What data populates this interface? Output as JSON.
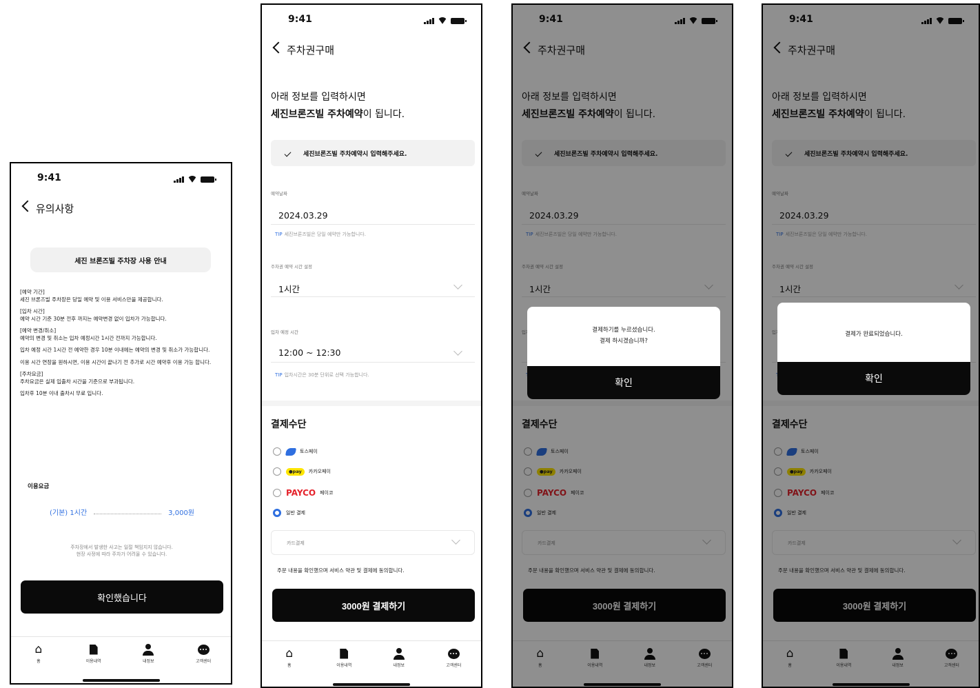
{
  "status_bar": {
    "time": "9:41"
  },
  "tabbar": {
    "items": [
      {
        "label": "홈",
        "icon": "home-icon"
      },
      {
        "label": "이용내역",
        "icon": "document-icon"
      },
      {
        "label": "내정보",
        "icon": "person-icon"
      },
      {
        "label": "고객센터",
        "icon": "chat-icon"
      }
    ]
  },
  "notice_screen": {
    "title": "유의사항",
    "heading": "세진 브론즈빌 주차장 사용 안내",
    "sections": [
      {
        "title": "[예약 기간]",
        "body": "세진 브론즈빌 주차장은 당일 예약 및 이용 서비스만을 제공합니다."
      },
      {
        "title": "[입차 시간]",
        "body": "예약 시간 기준 30분 전후 까지는 예약변경 없이 입차가 가능합니다."
      },
      {
        "title": "[예약 변경/취소]",
        "body": "예약의 변경 및 취소는 입차 예정시간 1시간 전까지 가능합니다."
      },
      {
        "title": "",
        "body": "입차 예정 시간 1시간 전 예약한 경우 10분 이내에는 예약의 변경 및 취소가 가능합니다."
      },
      {
        "title": "",
        "body": "이용 시간 연장을 원하시면, 이용 시간이 끝나기 전 추가로 시간 예약후 이용 가능 합니다."
      },
      {
        "title": "[주차요금]",
        "body": "주차요금은 실제 입출차 시간을 기준으로 부과됩니다."
      },
      {
        "title": "",
        "body": "입차후 10분 이내 출차시 무료 입니다."
      }
    ],
    "fee_label": "이용요금",
    "fee_name": "(기본) 1시간",
    "fee_price": "3,000원",
    "disclaimer_1": "주차장에서 발생한 사고는 일절 책임지지 않습니다.",
    "disclaimer_2": "현장 사정에 따라 주차가 어려울 수 있습니다.",
    "confirm_button": "확인했습니다"
  },
  "purchase": {
    "title": "주차권구매",
    "intro_line1": "아래 정보를 입력하시면",
    "intro_bold": "세진브론즈빌 주차예약",
    "intro_rest": "이 됩니다.",
    "check_text": "세진브론즈빌 주차예약시 입력해주세요.",
    "date_label": "예약날짜",
    "date_value": "2024.03.29",
    "date_tip_key": "TIP",
    "date_tip": "세진브론즈빌은 당일 예약만 가능합니다.",
    "duration_label": "주차권 예약 시간 설정",
    "duration_value": "1시간",
    "time_label": "입차 예정 시간",
    "time_value": "12:00 ~ 12:30",
    "time_tip_key": "TIP",
    "time_tip": "입차시간은 30분 단위로 선택 가능합니다.",
    "payment_title": "결제수단",
    "payment_options": [
      {
        "label": "토스페이",
        "logo": "toss-logo-icon",
        "selected": false
      },
      {
        "label": "카카오페이",
        "logo": "kakaopay-logo-icon",
        "logo_text": "●pay",
        "selected": false
      },
      {
        "label": "페이코",
        "logo": "payco-logo-icon",
        "logo_text": "PAYCO",
        "selected": false
      },
      {
        "label": "일반 결제",
        "logo": "",
        "selected": true
      }
    ],
    "card_select": "카드결제",
    "agree_text": "주문 내용을 확인했으며 서비스 약관 및 결제에 동의합니다.",
    "pay_button": "3000원 결제하기"
  },
  "confirm_modal": {
    "line1": "결제하기를 누르셨습니다.",
    "line2": "결제 하시겠습니까?",
    "button": "확인"
  },
  "done_modal": {
    "line1": "결제가 완료되었습니다.",
    "button": "확인"
  },
  "colors": {
    "accent_blue": "#2f6fe0",
    "primary_black": "#0a0a0a",
    "payco_red": "#e5232c",
    "kakao_yellow": "#fee500"
  }
}
